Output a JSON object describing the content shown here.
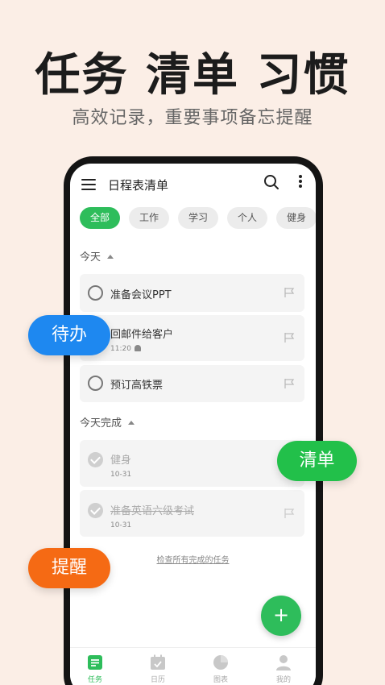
{
  "hero": {
    "title": "任务 清单 习惯",
    "subtitle": "高效记录，重要事项备忘提醒"
  },
  "app": {
    "title": "日程表清单",
    "icons": {
      "menu": "menu-icon",
      "search": "search-icon",
      "more": "more-vertical-icon"
    }
  },
  "filters": {
    "chips": [
      "全部",
      "工作",
      "学习",
      "个人",
      "健身"
    ],
    "selected": "全部"
  },
  "sections": {
    "today_label": "今天",
    "today_done_label": "今天完成"
  },
  "tasks_today": [
    {
      "title": "准备会议PPT",
      "meta": ""
    },
    {
      "title": "回邮件给客户",
      "meta": "11:20"
    },
    {
      "title": "预订高铁票",
      "meta": ""
    }
  ],
  "tasks_done": [
    {
      "title": "健身",
      "meta": "10-31"
    },
    {
      "title": "准备英语六级考试",
      "meta": "10-31"
    }
  ],
  "footer_link": "检查所有完成的任务",
  "fab_label": "+",
  "tabbar": {
    "items": [
      {
        "label": "任务",
        "icon": "task-icon"
      },
      {
        "label": "日历",
        "icon": "calendar-icon"
      },
      {
        "label": "图表",
        "icon": "pie-chart-icon"
      },
      {
        "label": "我的",
        "icon": "profile-icon"
      }
    ],
    "active": "任务"
  },
  "bubbles": {
    "todo": "待办",
    "list": "清单",
    "remind": "提醒"
  },
  "colors": {
    "background": "#fbeee6",
    "accent_green": "#2ebd5b",
    "bubble_blue": "#1e88f0",
    "bubble_green": "#22c04a",
    "bubble_orange": "#f56a14"
  }
}
